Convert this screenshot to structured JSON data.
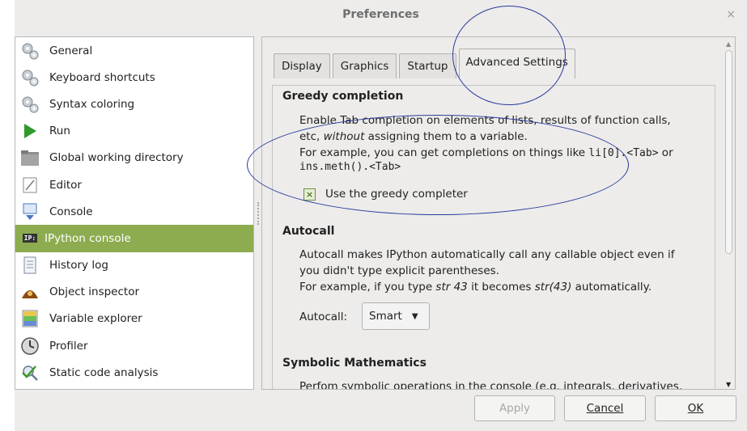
{
  "window": {
    "title": "Preferences",
    "close_glyph": "×"
  },
  "sidebar": {
    "items": [
      {
        "label": "General",
        "icon": "gears-icon"
      },
      {
        "label": "Keyboard shortcuts",
        "icon": "gears-icon"
      },
      {
        "label": "Syntax coloring",
        "icon": "gears-icon"
      },
      {
        "label": "Run",
        "icon": "play-icon"
      },
      {
        "label": "Global working directory",
        "icon": "folder-icon"
      },
      {
        "label": "Editor",
        "icon": "editor-icon"
      },
      {
        "label": "Console",
        "icon": "console-icon"
      },
      {
        "label": "IPython console",
        "icon": "ipython-icon",
        "selected": true,
        "badge": "IP:"
      },
      {
        "label": "History log",
        "icon": "history-icon"
      },
      {
        "label": "Object inspector",
        "icon": "inspector-icon"
      },
      {
        "label": "Variable explorer",
        "icon": "variable-explorer-icon"
      },
      {
        "label": "Profiler",
        "icon": "profiler-icon"
      },
      {
        "label": "Static code analysis",
        "icon": "code-analysis-icon"
      }
    ]
  },
  "tabs": [
    "Display",
    "Graphics",
    "Startup",
    "Advanced Settings"
  ],
  "active_tab": "Advanced Settings",
  "greedy": {
    "title": "Greedy completion",
    "line1": "Enable Tab completion on elements of lists, results of function calls,",
    "line2a": "etc, ",
    "line2b": "without",
    "line2c": " assigning them to a variable.",
    "line3a": "For example, you can get completions on things like ",
    "line3b": "li[0].<Tab>",
    "line3c": " or",
    "line4": "ins.meth().<Tab>",
    "checkbox_label": "Use the greedy completer",
    "checkbox_glyph": "×"
  },
  "autocall": {
    "title": "Autocall",
    "line1": "Autocall makes IPython automatically call any callable object even if",
    "line2": "you didn't type explicit parentheses.",
    "line3a": "For example, if you type ",
    "line3b": "str 43",
    "line3c": " it becomes ",
    "line3d": "str(43)",
    "line3e": " automatically.",
    "label": "Autocall:",
    "value": "Smart",
    "arrow": "▼"
  },
  "symbolic": {
    "title": "Symbolic Mathematics",
    "line1": "Perfom symbolic operations in the console (e.g. integrals, derivatives,"
  },
  "scrollbar": {
    "up": "▲",
    "down": "▼"
  },
  "buttons": {
    "apply": "Apply",
    "cancel": "Cancel",
    "ok": "OK"
  }
}
